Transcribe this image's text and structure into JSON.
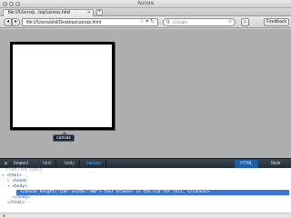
{
  "window": {
    "title": "Aurora"
  },
  "tabs": [
    {
      "label": "file:///Users/p...top/canvas.html"
    }
  ],
  "toolbar": {
    "url": "file:///Users/phil/Desktop/canvas.html",
    "search_placeholder": "Google",
    "feedback_label": "Feedback"
  },
  "page": {
    "canvas_tooltip": "canvas"
  },
  "devtools": {
    "inspect_label": "Inspect",
    "breadcrumbs": [
      "html",
      "body",
      "canvas"
    ],
    "html_tab": "HTML",
    "style_tab": "Style",
    "markup": {
      "doctype": "<!DOCTYPE html>",
      "html_open": "<html>",
      "head": "<head>",
      "body_open": "<body>",
      "canvas": "<canvas height=\"150\" width=\"300\"> Your browser is too old for this. </canvas>",
      "body_close": "</body>",
      "html_close": "</html>"
    }
  },
  "colors": {
    "selection": "#3875d7",
    "devtools_bg": "#2a343e",
    "accent": "#1a5fa8"
  }
}
